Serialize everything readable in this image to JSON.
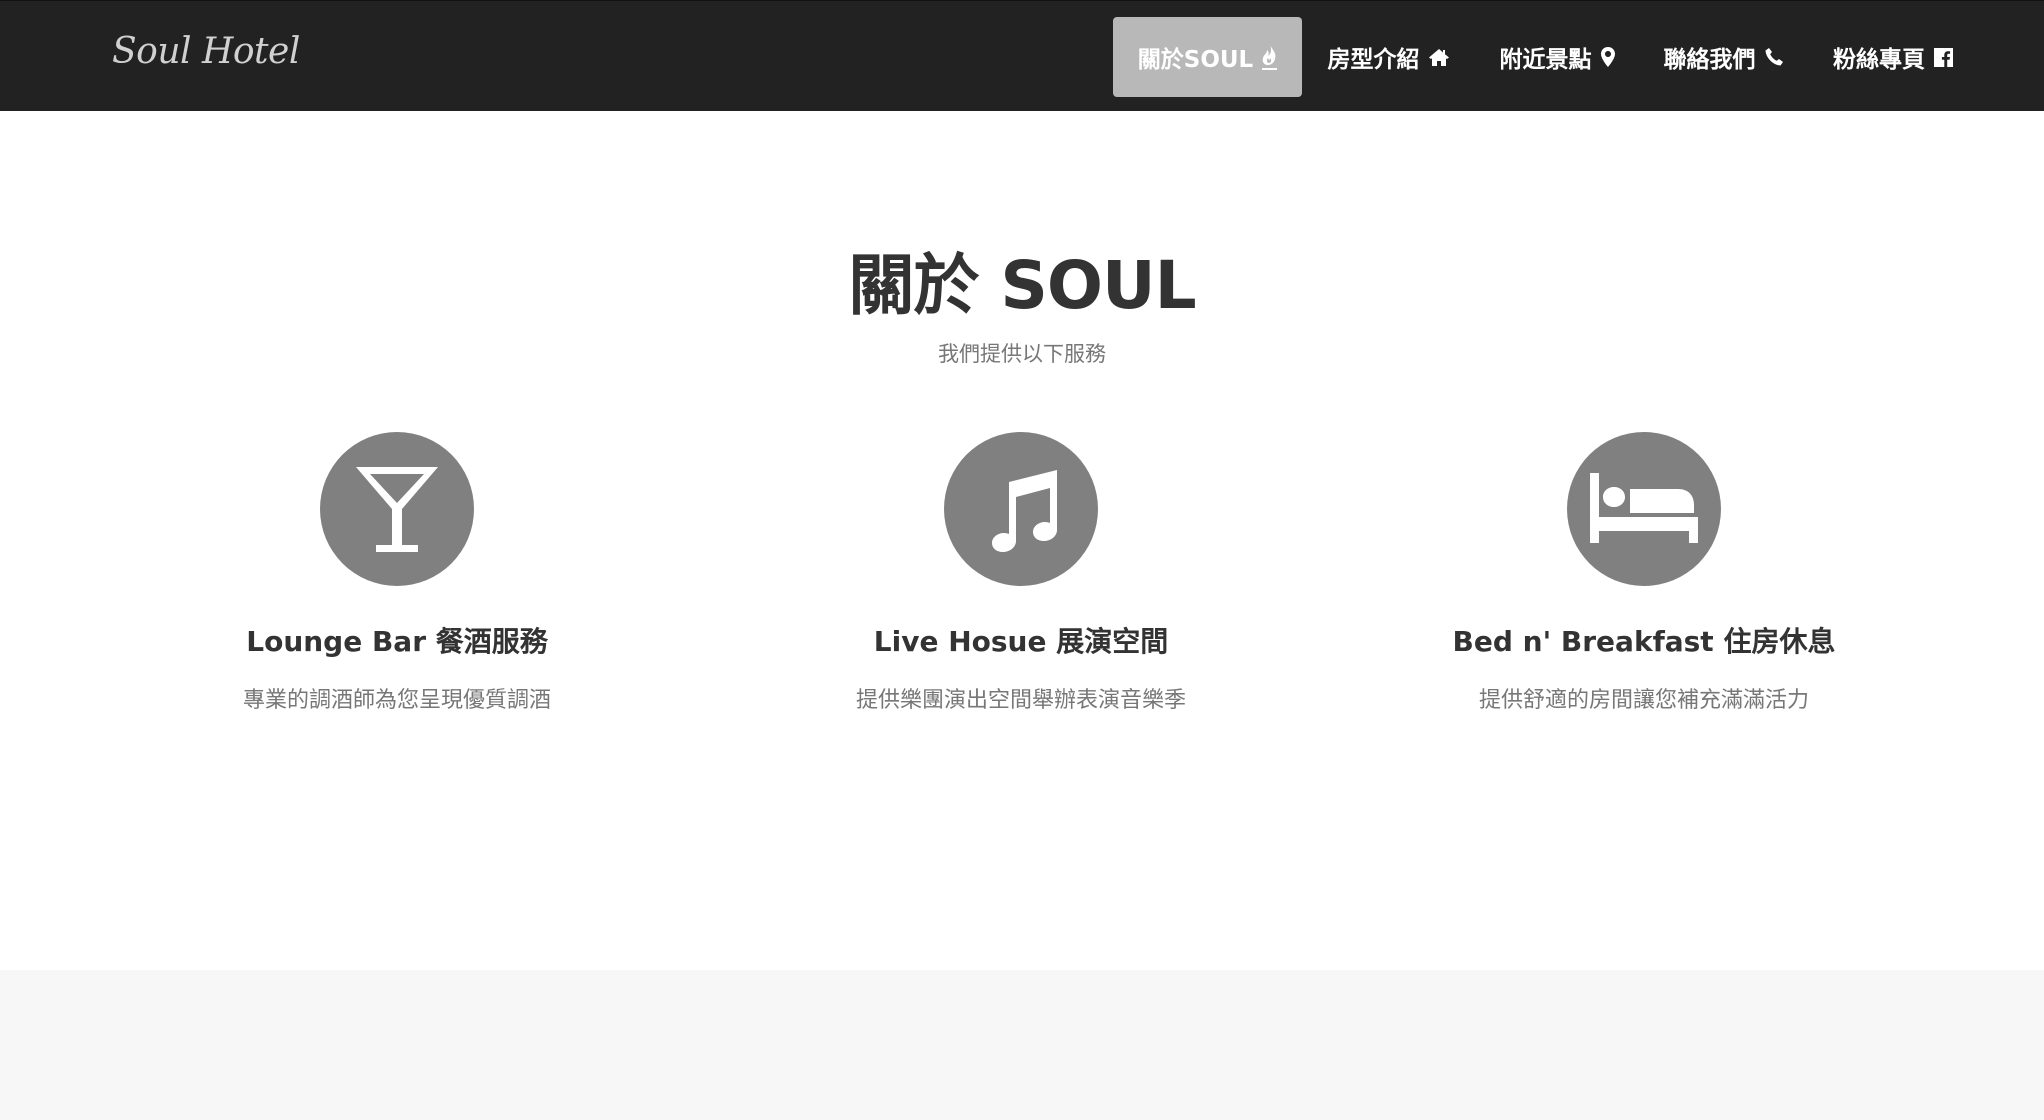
{
  "brand": {
    "name": "Soul Hotel"
  },
  "nav": {
    "items": [
      {
        "label": "關於SOUL",
        "icon": "fire-icon"
      },
      {
        "label": "房型介紹",
        "icon": "home-icon"
      },
      {
        "label": "附近景點",
        "icon": "map-marker-icon"
      },
      {
        "label": "聯絡我們",
        "icon": "phone-icon"
      },
      {
        "label": "粉絲專頁",
        "icon": "facebook-icon"
      }
    ],
    "active_index": 0
  },
  "about": {
    "title": "關於 SOUL",
    "subtitle": "我們提供以下服務",
    "services": [
      {
        "icon": "cocktail-glass-icon",
        "title": "Lounge Bar 餐酒服務",
        "description": "專業的調酒師為您呈現優質調酒"
      },
      {
        "icon": "music-note-icon",
        "title": "Live Hosue 展演空間",
        "description": "提供樂團演出空間舉辦表演音樂季"
      },
      {
        "icon": "bed-icon",
        "title": "Bed n' Breakfast 住房休息",
        "description": "提供舒適的房間讓您補充滿滿活力"
      }
    ]
  },
  "colors": {
    "navbar_bg": "#222222",
    "active_nav_bg": "#b8b8b8",
    "icon_circle": "#808080",
    "heading": "#333333",
    "muted_text": "#777777",
    "footer_band": "#f7f7f7"
  }
}
